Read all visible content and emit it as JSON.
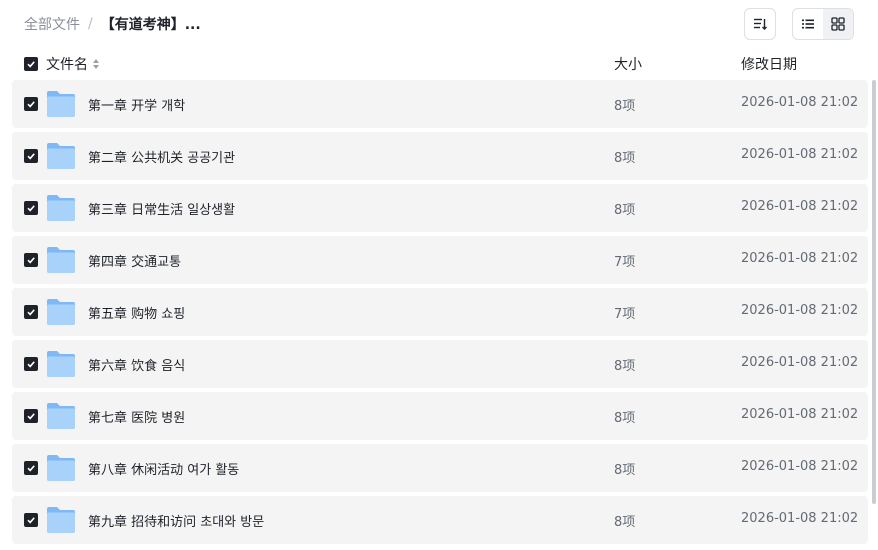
{
  "breadcrumb": {
    "root": "全部文件",
    "separator": "/",
    "current": "【有道考神】..."
  },
  "toolbar": {
    "sort_icon": "sort-lines-icon",
    "list_view_icon": "list-view-icon",
    "grid_view_icon": "grid-view-icon",
    "active_view": "list"
  },
  "columns": {
    "name": "文件名",
    "size": "大小",
    "modified": "修改日期"
  },
  "rows": [
    {
      "name": "第一章 开学 개학",
      "size": "8项",
      "modified": "2026-01-08 21:02",
      "checked": true
    },
    {
      "name": "第二章 公共机关 공공기관",
      "size": "8项",
      "modified": "2026-01-08 21:02",
      "checked": true
    },
    {
      "name": "第三章 日常生活 일상생활",
      "size": "8项",
      "modified": "2026-01-08 21:02",
      "checked": true
    },
    {
      "name": "第四章 交通교통",
      "size": "7项",
      "modified": "2026-01-08 21:02",
      "checked": true
    },
    {
      "name": "第五章 购物 쇼핑",
      "size": "7项",
      "modified": "2026-01-08 21:02",
      "checked": true
    },
    {
      "name": "第六章 饮食 음식",
      "size": "8项",
      "modified": "2026-01-08 21:02",
      "checked": true
    },
    {
      "name": "第七章 医院 병원",
      "size": "8项",
      "modified": "2026-01-08 21:02",
      "checked": true
    },
    {
      "name": "第八章 休闲活动 여가 활동",
      "size": "8项",
      "modified": "2026-01-08 21:02",
      "checked": true
    },
    {
      "name": "第九章 招待和访问 초대와 방문",
      "size": "8项",
      "modified": "2026-01-08 21:02",
      "checked": true
    }
  ],
  "colors": {
    "row_bg": "#f4f4f5",
    "checkbox": "#1f2329",
    "folder_back": "#7fb8f4",
    "folder_front": "#a9d2fb"
  }
}
